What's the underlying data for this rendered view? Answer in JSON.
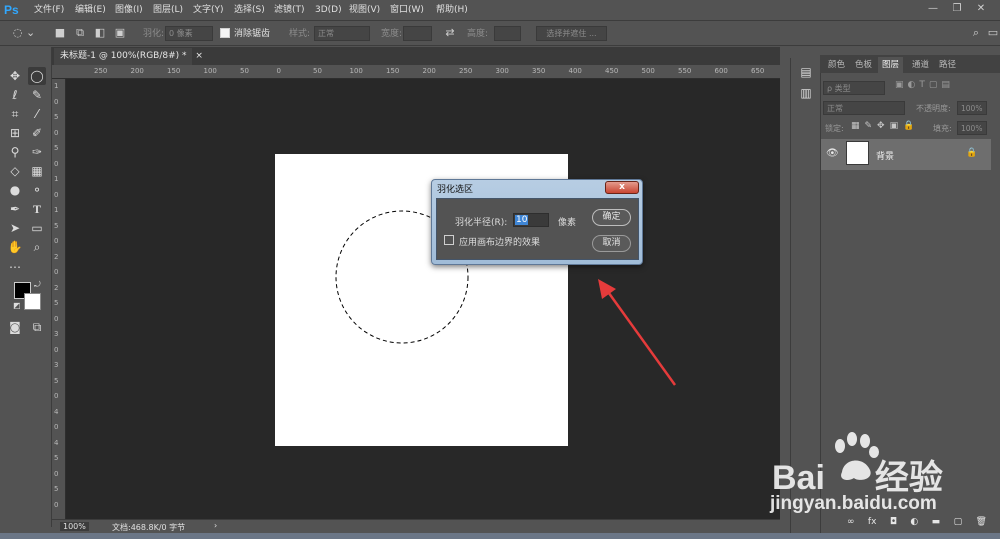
{
  "app": {
    "logo": "Ps"
  },
  "menu": [
    "文件(F)",
    "编辑(E)",
    "图像(I)",
    "图层(L)",
    "文字(Y)",
    "选择(S)",
    "滤镜(T)",
    "3D(D)",
    "视图(V)",
    "窗口(W)",
    "帮助(H)"
  ],
  "window_controls": {
    "minimize": "—",
    "restore": "❐",
    "close": "✕"
  },
  "options": {
    "feather_label": "羽化:",
    "feather_value": "0 像素",
    "antialias_label": "消除锯齿",
    "style_label": "样式:",
    "style_value": "正常",
    "width_label": "宽度:",
    "height_label": "高度:",
    "select_mask_button": "选择并遮住 ..."
  },
  "document_tab": {
    "title": "未标题-1 @ 100%(RGB/8#) *",
    "close": "×"
  },
  "ruler_top": [
    "250",
    "200",
    "150",
    "100",
    "50",
    "0",
    "50",
    "100",
    "150",
    "200",
    "250",
    "300",
    "350",
    "400",
    "450",
    "500",
    "550",
    "600",
    "650"
  ],
  "ruler_left": [
    "1",
    "0",
    "5",
    "0",
    "5",
    "0",
    "1",
    "0",
    "1",
    "5",
    "0",
    "2",
    "0",
    "2",
    "5",
    "0",
    "3",
    "0",
    "3",
    "5",
    "0",
    "4",
    "0",
    "4",
    "5",
    "0",
    "5",
    "0"
  ],
  "status": {
    "zoom": "100%",
    "doc_info": "文档:468.8K/0 字节",
    "arrow": "›"
  },
  "panel_tabs": [
    "颜色",
    "色板",
    "图层",
    "通道",
    "路径"
  ],
  "layers": {
    "filter_label": "ρ 类型",
    "blend_mode": "正常",
    "opacity_label": "不透明度:",
    "opacity_value": "100%",
    "lock_label": "锁定:",
    "fill_label": "填充:",
    "fill_value": "100%",
    "layer_name": "背景",
    "footer_icons": [
      "∞",
      "fx",
      "◘",
      "◐",
      "▬",
      "▢",
      "🗑"
    ]
  },
  "dialog": {
    "title": "羽化选区",
    "close": "x",
    "radius_label": "羽化半径(R):",
    "radius_value": "10",
    "unit": "像素",
    "checkbox_label": "应用画布边界的效果",
    "ok": "确定",
    "cancel": "取消"
  },
  "watermark": {
    "main": "Bai",
    "cn": "经验",
    "url": "jingyan.baidu.com"
  },
  "colors": {
    "accent": "#31a8ff",
    "arrow": "#e53b3b",
    "dialog_frame": "#a0bcd8"
  }
}
